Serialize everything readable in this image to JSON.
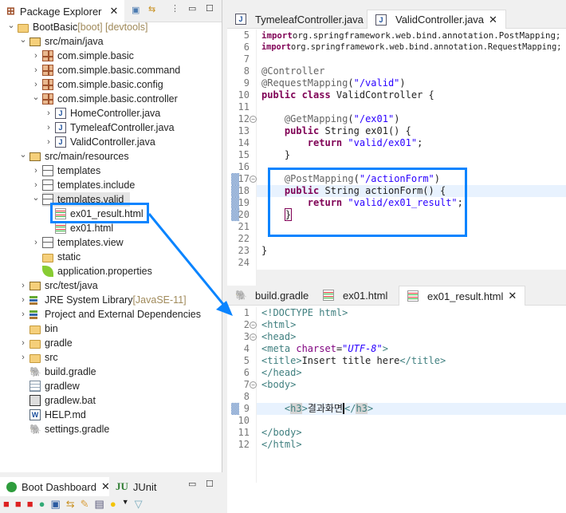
{
  "explorer": {
    "tab_label": "Package Explorer",
    "items": [
      {
        "label": "BootBasic",
        "deco": " [boot] [devtools]",
        "level": 0,
        "chev": "open",
        "icon": "project"
      },
      {
        "label": "src/main/java",
        "level": 1,
        "chev": "open",
        "icon": "src"
      },
      {
        "label": "com.simple.basic",
        "level": 2,
        "chev": "closed",
        "icon": "pkg"
      },
      {
        "label": "com.simple.basic.command",
        "level": 2,
        "chev": "closed",
        "icon": "pkg"
      },
      {
        "label": "com.simple.basic.config",
        "level": 2,
        "chev": "closed",
        "icon": "pkg"
      },
      {
        "label": "com.simple.basic.controller",
        "level": 2,
        "chev": "open",
        "icon": "pkg"
      },
      {
        "label": "HomeController.java",
        "level": 3,
        "chev": "closed",
        "icon": "jfile"
      },
      {
        "label": "TymeleafController.java",
        "level": 3,
        "chev": "closed",
        "icon": "jfile"
      },
      {
        "label": "ValidController.java",
        "level": 3,
        "chev": "closed",
        "icon": "jfile"
      },
      {
        "label": "src/main/resources",
        "level": 1,
        "chev": "open",
        "icon": "src"
      },
      {
        "label": "templates",
        "level": 2,
        "chev": "closed",
        "icon": "tpl"
      },
      {
        "label": "templates.include",
        "level": 2,
        "chev": "closed",
        "icon": "tpl"
      },
      {
        "label": "templates.valid",
        "level": 2,
        "chev": "open",
        "icon": "tpl",
        "selected": true
      },
      {
        "label": "ex01_result.html",
        "level": 3,
        "chev": "none",
        "icon": "hfile",
        "highlight": true
      },
      {
        "label": "ex01.html",
        "level": 3,
        "chev": "none",
        "icon": "hfile"
      },
      {
        "label": "templates.view",
        "level": 2,
        "chev": "closed",
        "icon": "tpl"
      },
      {
        "label": "static",
        "level": 2,
        "chev": "none",
        "icon": "folder"
      },
      {
        "label": "application.properties",
        "level": 2,
        "chev": "none",
        "icon": "leaf"
      },
      {
        "label": "src/test/java",
        "level": 1,
        "chev": "closed",
        "icon": "src"
      },
      {
        "label": "JRE System Library",
        "deco": " [JavaSE-11]",
        "level": 1,
        "chev": "closed",
        "icon": "lib"
      },
      {
        "label": "Project and External Dependencies",
        "level": 1,
        "chev": "closed",
        "icon": "lib"
      },
      {
        "label": "bin",
        "level": 1,
        "chev": "none",
        "icon": "folder"
      },
      {
        "label": "gradle",
        "level": 1,
        "chev": "closed",
        "icon": "folder"
      },
      {
        "label": "src",
        "level": 1,
        "chev": "closed",
        "icon": "folder"
      },
      {
        "label": "build.gradle",
        "level": 1,
        "chev": "none",
        "icon": "eleph"
      },
      {
        "label": "gradlew",
        "level": 1,
        "chev": "none",
        "icon": "doc"
      },
      {
        "label": "gradlew.bat",
        "level": 1,
        "chev": "none",
        "icon": "bat"
      },
      {
        "label": "HELP.md",
        "level": 1,
        "chev": "none",
        "icon": "word"
      },
      {
        "label": "settings.gradle",
        "level": 1,
        "chev": "none",
        "icon": "eleph"
      }
    ]
  },
  "bottom_left": {
    "tabs": [
      {
        "label": "Boot Dashboard",
        "icon": "spring-boot-icon"
      },
      {
        "label": "JUnit",
        "icon": "junit-icon",
        "prefix": "JU"
      }
    ]
  },
  "top_editor": {
    "tabs": [
      {
        "label": "TymeleafController.java"
      },
      {
        "label": "ValidController.java",
        "active": true
      }
    ],
    "lines": [
      {
        "n": "5",
        "tokens": [
          [
            "kw",
            "import"
          ],
          [
            "",
            "org.springframework.web.bind.annotation.PostMapping;"
          ]
        ]
      },
      {
        "n": "6",
        "tokens": [
          [
            "kw",
            "import"
          ],
          [
            "",
            "org.springframework.web.bind.annotation.RequestMapping;"
          ]
        ]
      },
      {
        "n": "7",
        "tokens": []
      },
      {
        "n": "8",
        "tokens": [
          [
            "ann",
            "@Controller"
          ]
        ]
      },
      {
        "n": "9",
        "tokens": [
          [
            "ann",
            "@RequestMapping"
          ],
          [
            "",
            "("
          ],
          [
            "str",
            "\"/valid\""
          ],
          [
            "",
            ")"
          ]
        ]
      },
      {
        "n": "10",
        "tokens": [
          [
            "kw",
            "public class"
          ],
          [
            "",
            " ValidController {"
          ]
        ]
      },
      {
        "n": "11",
        "tokens": []
      },
      {
        "n": "12",
        "fold": true,
        "tokens": [
          [
            "",
            "    "
          ],
          [
            "ann",
            "@GetMapping"
          ],
          [
            "",
            "("
          ],
          [
            "str",
            "\"/ex01\""
          ],
          [
            "",
            ")"
          ]
        ]
      },
      {
        "n": "13",
        "tokens": [
          [
            "",
            "    "
          ],
          [
            "kw",
            "public"
          ],
          [
            "",
            " String ex01() {"
          ]
        ]
      },
      {
        "n": "14",
        "tokens": [
          [
            "",
            "        "
          ],
          [
            "kw",
            "return"
          ],
          [
            "",
            " "
          ],
          [
            "str",
            "\"valid/ex01\""
          ],
          [
            "",
            ";"
          ]
        ]
      },
      {
        "n": "15",
        "tokens": [
          [
            "",
            "    }"
          ]
        ]
      },
      {
        "n": "16",
        "tokens": []
      },
      {
        "n": "17",
        "fold": true,
        "mark": true,
        "tokens": [
          [
            "",
            "    "
          ],
          [
            "ann",
            "@PostMapping"
          ],
          [
            "",
            "("
          ],
          [
            "str",
            "\"/actionForm\""
          ],
          [
            "",
            ")"
          ]
        ]
      },
      {
        "n": "18",
        "current": true,
        "mark": true,
        "tokens": [
          [
            "",
            "    "
          ],
          [
            "kw",
            "public"
          ],
          [
            "",
            " String actionForm() {"
          ]
        ]
      },
      {
        "n": "19",
        "mark": true,
        "tokens": [
          [
            "",
            "        "
          ],
          [
            "kw",
            "return"
          ],
          [
            "",
            " "
          ],
          [
            "str",
            "\"valid/ex01_result\""
          ],
          [
            "",
            ";"
          ]
        ]
      },
      {
        "n": "20",
        "mark": true,
        "tokens": [
          [
            "",
            "    "
          ],
          [
            "caret",
            "}"
          ]
        ]
      },
      {
        "n": "21",
        "tokens": []
      },
      {
        "n": "22",
        "tokens": []
      },
      {
        "n": "23",
        "tokens": [
          [
            "",
            "}"
          ]
        ]
      },
      {
        "n": "24",
        "tokens": []
      }
    ]
  },
  "bottom_editor": {
    "tabs": [
      {
        "label": "build.gradle",
        "icon": "gradle-icon"
      },
      {
        "label": "ex01.html",
        "icon": "html-file-icon"
      },
      {
        "label": "ex01_result.html",
        "icon": "html-file-icon",
        "active": true
      }
    ],
    "lines": [
      {
        "n": "1",
        "tokens": [
          [
            "tag",
            "<!DOCTYPE html>"
          ]
        ]
      },
      {
        "n": "2",
        "fold": true,
        "tokens": [
          [
            "tag",
            "<html>"
          ]
        ]
      },
      {
        "n": "3",
        "fold": true,
        "tokens": [
          [
            "tag",
            "<head>"
          ]
        ]
      },
      {
        "n": "4",
        "tokens": [
          [
            "tag",
            "<meta "
          ],
          [
            "attr",
            "charset"
          ],
          [
            "",
            "="
          ],
          [
            "aval",
            "\"UTF-8\""
          ],
          [
            "tag",
            ">"
          ]
        ]
      },
      {
        "n": "5",
        "tokens": [
          [
            "tag",
            "<title>"
          ],
          [
            "",
            "Insert title here"
          ],
          [
            "tag",
            "</title>"
          ]
        ]
      },
      {
        "n": "6",
        "tokens": [
          [
            "tag",
            "</head>"
          ]
        ]
      },
      {
        "n": "7",
        "fold": true,
        "tokens": [
          [
            "tag",
            "<body>"
          ]
        ]
      },
      {
        "n": "8",
        "tokens": []
      },
      {
        "n": "9",
        "current": true,
        "mark": true,
        "tokens": [
          [
            "",
            "    "
          ],
          [
            "tag",
            "<"
          ],
          [
            "tagh",
            "h3"
          ],
          [
            "tag",
            ">"
          ],
          [
            "cursor",
            "결과화면"
          ],
          [
            "tag",
            "</"
          ],
          [
            "tagh",
            "h3"
          ],
          [
            "tag",
            ">"
          ]
        ]
      },
      {
        "n": "10",
        "tokens": []
      },
      {
        "n": "11",
        "tokens": [
          [
            "tag",
            "</body>"
          ]
        ]
      },
      {
        "n": "12",
        "tokens": [
          [
            "tag",
            "</html>"
          ]
        ]
      }
    ]
  },
  "colors": {
    "annotation_blue": "#0a84ff",
    "keyword": "#7f0055",
    "string": "#2a00ff"
  }
}
